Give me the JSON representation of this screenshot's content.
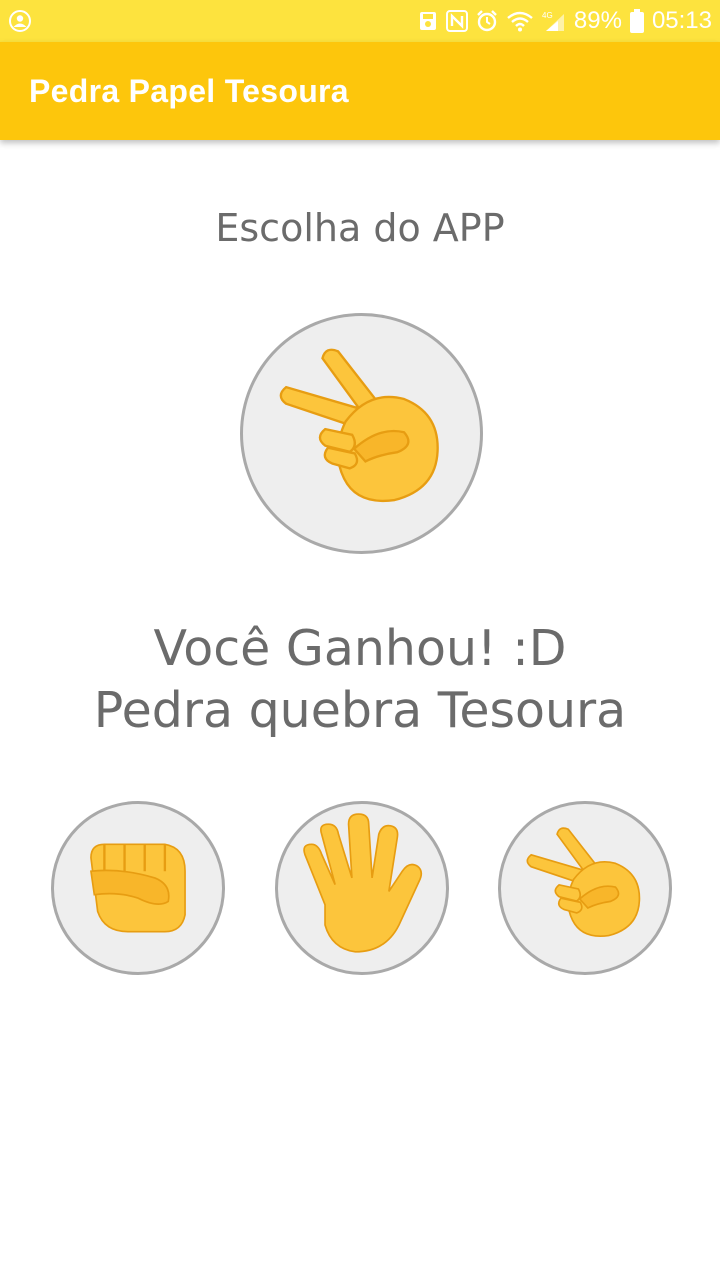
{
  "status_bar": {
    "battery": "89%",
    "time": "05:13",
    "network": "4G"
  },
  "app_bar": {
    "title": "Pedra Papel Tesoura"
  },
  "main": {
    "heading": "Escolha do APP",
    "app_choice": {
      "icon": "scissors-hand-icon"
    },
    "result_line1": "Você Ganhou! :D",
    "result_line2": "Pedra quebra Tesoura",
    "options": [
      {
        "icon": "rock-fist-icon"
      },
      {
        "icon": "paper-hand-icon"
      },
      {
        "icon": "scissors-hand-icon"
      }
    ]
  },
  "colors": {
    "status_bar": "#fde33e",
    "app_bar": "#fdc60c",
    "text": "#6b6b6b",
    "circle_bg": "#eeeeee",
    "circle_border": "#a9a9a9",
    "emoji_yellow": "#fcc53c",
    "emoji_shade": "#f0a21a"
  }
}
